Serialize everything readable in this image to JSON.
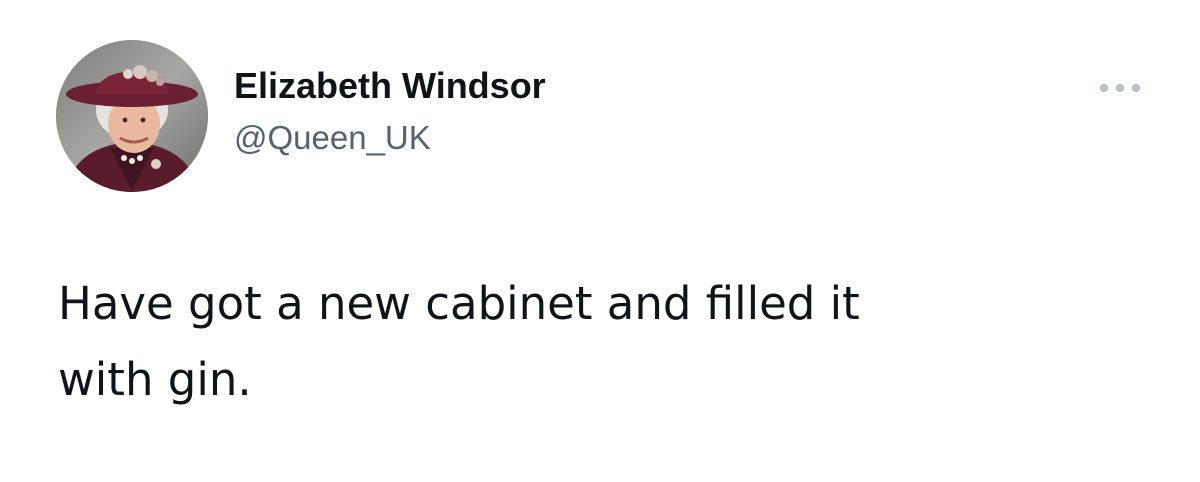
{
  "tweet": {
    "author": {
      "display_name": "Elizabeth Windsor",
      "handle": "@Queen_UK",
      "avatar": "profile-photo"
    },
    "text": "Have got a new cabinet and filled it\nwith gin.",
    "more_icon": "ellipsis-icon"
  },
  "colors": {
    "text_primary": "#0f1419",
    "text_secondary": "#536471",
    "icon_muted": "#b8c0c8",
    "background": "#ffffff"
  }
}
